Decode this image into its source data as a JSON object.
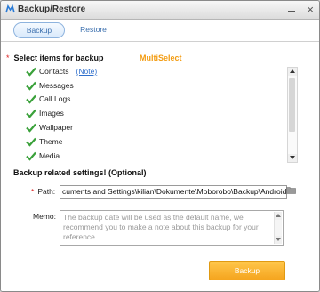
{
  "window": {
    "title": "Backup/Restore",
    "close_glyph": "×"
  },
  "tabs": [
    {
      "label": "Backup",
      "active": true
    },
    {
      "label": "Restore",
      "active": false
    }
  ],
  "items_section": {
    "asterisk": "*",
    "header": "Select items for backup",
    "multiselect_label": "MultiSelect",
    "items": [
      {
        "label": "Contacts",
        "checked": true,
        "link": "(Note)"
      },
      {
        "label": "Messages",
        "checked": true
      },
      {
        "label": "Call Logs",
        "checked": true
      },
      {
        "label": "Images",
        "checked": true
      },
      {
        "label": "Wallpaper",
        "checked": true
      },
      {
        "label": "Theme",
        "checked": true
      },
      {
        "label": "Media",
        "checked": true
      }
    ]
  },
  "settings": {
    "header": "Backup related settings! (Optional)",
    "path_asterisk": "*",
    "path_label": "Path:",
    "path_value": "cuments and Settings\\kilian\\Dokumente\\Moborobo\\Backup\\Android",
    "memo_label": "Memo:",
    "memo_placeholder": "The backup date will be used as the default name, we recommend you to make a note about this backup for your reference."
  },
  "actions": {
    "backup_label": "Backup"
  },
  "colors": {
    "accent_orange": "#f39c12",
    "link_blue": "#2f6fcc",
    "check_green": "#3aa13a",
    "required_red": "#d22222"
  }
}
